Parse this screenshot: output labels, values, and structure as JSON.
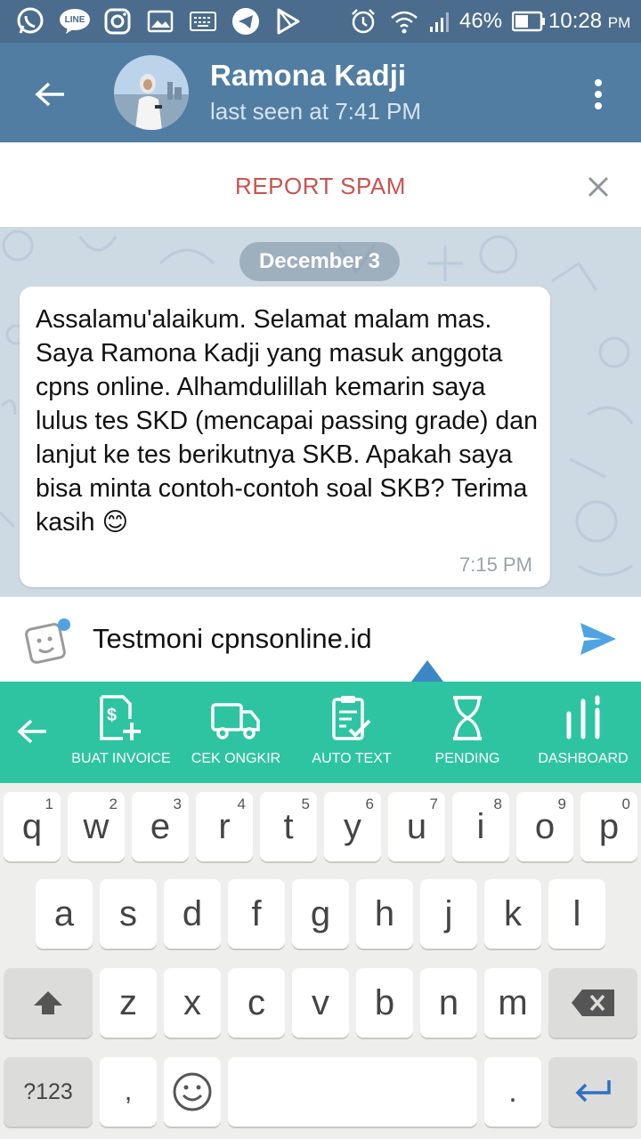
{
  "status_bar": {
    "battery_percent": "46%",
    "time": "10:28",
    "time_suffix": "PM",
    "line_label": "LINE",
    "left_icons": [
      "whatsapp-icon",
      "line-icon",
      "instagram-icon",
      "gallery-icon",
      "keyboard-icon",
      "telegram-icon",
      "play-store-icon"
    ],
    "right_icons": [
      "alarm-icon",
      "wifi-icon",
      "signal-icon",
      "battery-icon"
    ]
  },
  "header": {
    "title": "Ramona Kadji",
    "subtitle": "last seen at 7:41 PM"
  },
  "report_bar": {
    "label": "REPORT SPAM"
  },
  "chat": {
    "date": "December 3",
    "message": {
      "text": "Assalamu'alaikum. Selamat malam mas. Saya Ramona Kadji yang masuk anggota cpns online. Alhamdulillah kemarin saya lulus tes SKD (mencapai passing grade) dan lanjut ke tes berikutnya SKB. Apakah saya bisa minta contoh-contoh soal SKB? Terima kasih 😊",
      "time": "7:15 PM"
    }
  },
  "input": {
    "value": "Testmoni cpnsonline.id"
  },
  "toolbar": {
    "items": [
      {
        "label": "BUAT INVOICE"
      },
      {
        "label": "CEK ONGKIR"
      },
      {
        "label": "AUTO TEXT"
      },
      {
        "label": "PENDING"
      },
      {
        "label": "DASHBOARD"
      }
    ]
  },
  "keyboard": {
    "row1": [
      {
        "key": "q",
        "num": "1"
      },
      {
        "key": "w",
        "num": "2"
      },
      {
        "key": "e",
        "num": "3"
      },
      {
        "key": "r",
        "num": "4"
      },
      {
        "key": "t",
        "num": "5"
      },
      {
        "key": "y",
        "num": "6"
      },
      {
        "key": "u",
        "num": "7"
      },
      {
        "key": "i",
        "num": "8"
      },
      {
        "key": "o",
        "num": "9"
      },
      {
        "key": "p",
        "num": "0"
      }
    ],
    "row2": [
      "a",
      "s",
      "d",
      "f",
      "g",
      "h",
      "j",
      "k",
      "l"
    ],
    "row3": [
      "z",
      "x",
      "c",
      "v",
      "b",
      "n",
      "m"
    ],
    "symbols_label": "?123",
    "comma_label": ",",
    "period_label": "."
  },
  "colors": {
    "header": "#517da2",
    "status_bar": "#4b6c8c",
    "report": "#c75450",
    "toolbar": "#2ec4a1",
    "send": "#4fa3e3"
  }
}
